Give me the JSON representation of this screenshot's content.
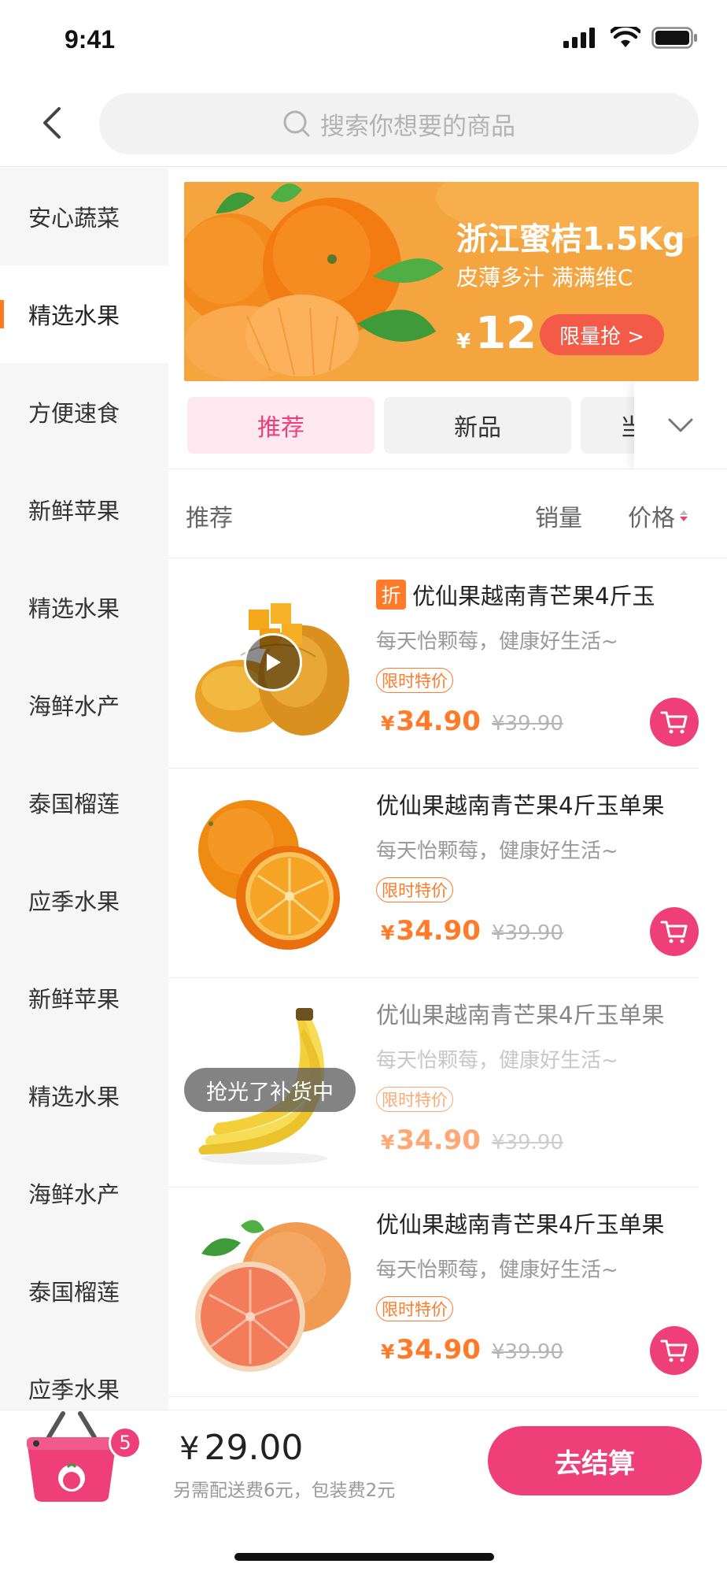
{
  "status_bar": {
    "time": "9:41"
  },
  "header": {
    "search_placeholder": "搜索你想要的商品"
  },
  "sidebar": {
    "items": [
      {
        "label": "安心蔬菜",
        "active": false
      },
      {
        "label": "精选水果",
        "active": true
      },
      {
        "label": "方便速食",
        "active": false
      },
      {
        "label": "新鲜苹果",
        "active": false
      },
      {
        "label": "精选水果",
        "active": false
      },
      {
        "label": "海鲜水产",
        "active": false
      },
      {
        "label": "泰国榴莲",
        "active": false
      },
      {
        "label": "应季水果",
        "active": false
      },
      {
        "label": "新鲜苹果",
        "active": false
      },
      {
        "label": "精选水果",
        "active": false
      },
      {
        "label": "海鲜水产",
        "active": false
      },
      {
        "label": "泰国榴莲",
        "active": false
      },
      {
        "label": "应季水果",
        "active": false
      }
    ]
  },
  "banner": {
    "title": "浙江蜜桔1.5Kg",
    "subtitle": "皮薄多汁 满满维C",
    "price_symbol": "¥",
    "price": "12",
    "button_label": "限量抢 >"
  },
  "tabs": [
    {
      "label": "推荐",
      "active": true
    },
    {
      "label": "新品",
      "active": false
    },
    {
      "label": "当",
      "active": false
    }
  ],
  "sort_bar": {
    "recommend": "推荐",
    "sales": "销量",
    "price": "价格"
  },
  "products": [
    {
      "badge": "折",
      "name": "优仙果越南青芒果4斤玉",
      "desc": "每天怡颗莓，健康好生活~",
      "tag": "限时特价",
      "price_symbol": "¥",
      "price": "34.90",
      "old_price": "¥39.90",
      "image": "mango",
      "sold_out": false,
      "has_video": true
    },
    {
      "badge": "",
      "name": "优仙果越南青芒果4斤玉单果",
      "desc": "每天怡颗莓，健康好生活~",
      "tag": "限时特价",
      "price_symbol": "¥",
      "price": "34.90",
      "old_price": "¥39.90",
      "image": "orange",
      "sold_out": false,
      "has_video": false
    },
    {
      "badge": "",
      "name": "优仙果越南青芒果4斤玉单果",
      "desc": "每天怡颗莓，健康好生活~",
      "tag": "限时特价",
      "price_symbol": "¥",
      "price": "34.90",
      "old_price": "¥39.90",
      "image": "banana",
      "sold_out": true,
      "sold_out_label": "抢光了补货中",
      "has_video": false
    },
    {
      "badge": "",
      "name": "优仙果越南青芒果4斤玉单果",
      "desc": "每天怡颗莓，健康好生活~",
      "tag": "限时特价",
      "price_symbol": "¥",
      "price": "34.90",
      "old_price": "¥39.90",
      "image": "grapefruit",
      "sold_out": false,
      "has_video": false
    }
  ],
  "bottom_bar": {
    "cart_count": "5",
    "total_symbol": "¥",
    "total": "29.00",
    "note": "另需配送费6元，包装费2元",
    "checkout_label": "去结算"
  },
  "colors": {
    "accent_pink": "#ee3f79",
    "accent_orange": "#ff7b2a",
    "banner_orange": "#f5a540"
  }
}
